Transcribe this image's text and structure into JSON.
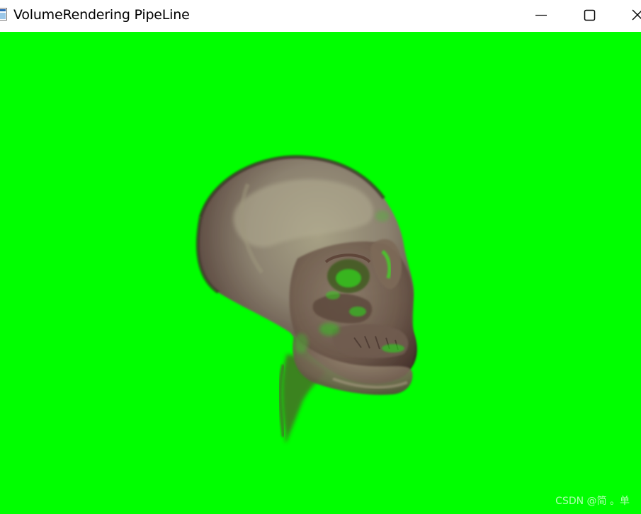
{
  "window": {
    "title": "VolumeRendering PipeLine",
    "app_icon": "vtk-window-icon",
    "controls": {
      "minimize_icon": "minimize-icon",
      "maximize_icon": "maximize-icon",
      "close_icon": "close-icon"
    }
  },
  "viewport": {
    "background_color": "#00ff00",
    "content": "volume-rendered-skull",
    "watermark": "CSDN @简 。单"
  },
  "colors": {
    "titlebar_bg": "#ffffff",
    "render_bg": "#00ff00",
    "bone_tone": "#8a7d6b"
  }
}
